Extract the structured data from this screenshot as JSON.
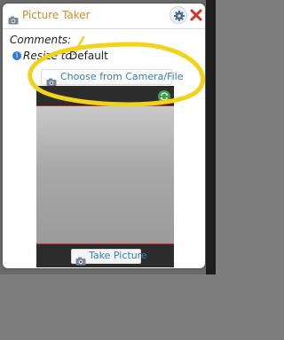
{
  "dialog": {
    "title": "Picture Taker",
    "title_color": "#d88a2a",
    "app_icon": "camera-icon",
    "settings_icon": "gear-icon",
    "close_icon": "close-icon"
  },
  "form": {
    "comments_label": "Comments:",
    "resize_label": "Resize to:",
    "resize_value": "Default",
    "info_icon": "info-icon"
  },
  "actions": {
    "choose_label": "Choose from Camera/File",
    "take_label": "Take Picture",
    "switch_camera_icon": "switch-camera-icon"
  },
  "colors": {
    "link_text": "#3a7fb0",
    "annotation": "#f2d31b",
    "close": "#d93025"
  }
}
